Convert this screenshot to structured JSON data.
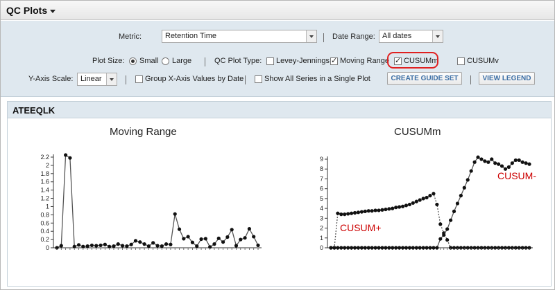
{
  "header": {
    "title": "QC Plots"
  },
  "controls": {
    "metric_label": "Metric:",
    "metric_value": "Retention Time",
    "date_range_label": "Date Range:",
    "date_range_value": "All dates",
    "plot_size_label": "Plot Size:",
    "plot_size_small": "Small",
    "plot_size_large": "Large",
    "plot_size_selected": "Small",
    "qc_plot_type_label": "QC Plot Type:",
    "qc_types": [
      {
        "label": "Levey-Jennings",
        "checked": false
      },
      {
        "label": "Moving Range",
        "checked": true
      },
      {
        "label": "CUSUMm",
        "checked": true
      },
      {
        "label": "CUSUMv",
        "checked": false
      }
    ],
    "y_axis_scale_label": "Y-Axis Scale:",
    "y_axis_scale_value": "Linear",
    "group_x_label": "Group X-Axis Values by Date",
    "show_all_label": "Show All Series in a Single Plot",
    "create_guide_set": "CREATE GUIDE SET",
    "view_legend": "VIEW LEGEND"
  },
  "panel": {
    "title": "ATEEQLK"
  },
  "annotations": {
    "cusum_plus": "CUSUM+",
    "cusum_minus": "CUSUM-"
  },
  "colors": {
    "highlight": "#e02020",
    "annotation": "#cc0000",
    "panel_bg": "#dfe8ef"
  },
  "chart_data": [
    {
      "type": "line",
      "title": "Moving Range",
      "xlabel": "",
      "ylabel": "",
      "ylim": [
        0,
        2.2
      ],
      "yticks": [
        "0",
        "0.2",
        "0.4",
        "0.6",
        "0.8",
        "1",
        "1.2",
        "1.4",
        "1.6",
        "1.8",
        "2",
        "2.2"
      ],
      "grid": false,
      "series": [
        {
          "values": [
            0,
            0.05,
            2.25,
            2.18,
            0.03,
            0.07,
            0.03,
            0.04,
            0.06,
            0.05,
            0.06,
            0.08,
            0.03,
            0.04,
            0.09,
            0.05,
            0.04,
            0.08,
            0.17,
            0.14,
            0.09,
            0.04,
            0.12,
            0.05,
            0.04,
            0.09,
            0.08,
            0.82,
            0.45,
            0.22,
            0.27,
            0.13,
            0.04,
            0.21,
            0.22,
            0.02,
            0.09,
            0.23,
            0.14,
            0.26,
            0.44,
            0.05,
            0.2,
            0.24,
            0.46,
            0.27,
            0.06
          ]
        }
      ]
    },
    {
      "type": "line",
      "title": "CUSUMm",
      "xlabel": "",
      "ylabel": "",
      "ylim": [
        0,
        9
      ],
      "yticks": [
        "0",
        "1",
        "2",
        "3",
        "4",
        "5",
        "6",
        "7",
        "8",
        "9"
      ],
      "grid": false,
      "series": [
        {
          "values": [
            0,
            0,
            3.5,
            3.4,
            3.4,
            3.45,
            3.5,
            3.55,
            3.6,
            3.65,
            3.7,
            3.75,
            3.75,
            3.8,
            3.8,
            3.85,
            3.9,
            3.95,
            4.0,
            4.1,
            4.15,
            4.2,
            4.3,
            4.4,
            4.55,
            4.7,
            4.85,
            5.0,
            5.1,
            5.3,
            5.5,
            4.4,
            2.4,
            1.5,
            0.8,
            0,
            0,
            0,
            0,
            0,
            0,
            0,
            0,
            0,
            0,
            0,
            0,
            0,
            0,
            0,
            0,
            0,
            0,
            0,
            0,
            0,
            0,
            0,
            0
          ]
        },
        {
          "values": [
            0,
            0,
            0,
            0,
            0,
            0,
            0,
            0,
            0,
            0,
            0,
            0,
            0,
            0,
            0,
            0,
            0,
            0,
            0,
            0,
            0,
            0,
            0,
            0,
            0,
            0,
            0,
            0,
            0,
            0,
            0,
            0,
            0.9,
            1.3,
            1.9,
            2.8,
            3.7,
            4.5,
            5.3,
            6.1,
            6.9,
            7.8,
            8.7,
            9.2,
            9.0,
            8.8,
            8.7,
            9.0,
            8.6,
            8.5,
            8.3,
            8.0,
            8.2,
            8.6,
            8.9,
            8.9,
            8.7,
            8.6,
            8.5
          ]
        }
      ]
    }
  ]
}
